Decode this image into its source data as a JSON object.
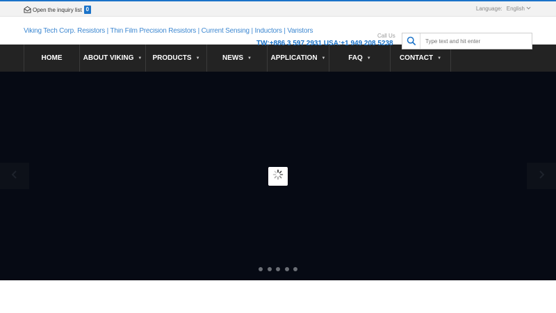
{
  "topbar": {
    "inquiry_label": "Open the inquiry list",
    "inquiry_count": "0",
    "language_label": "Language:",
    "language_value": "English"
  },
  "header": {
    "tagline": "Viking Tech Corp. Resistors | Thin Film Precision Resistors | Current Sensing | Inductors | Varistors",
    "call_us": "Call Us",
    "phone": "TW:+886 3 597 2931 USA:+1 949 208 5238"
  },
  "search": {
    "placeholder": "Type text and hit enter"
  },
  "nav": {
    "items": [
      {
        "label": "HOME",
        "has_dropdown": false
      },
      {
        "label": "ABOUT VIKING",
        "has_dropdown": true
      },
      {
        "label": "PRODUCTS",
        "has_dropdown": true
      },
      {
        "label": "NEWS",
        "has_dropdown": true
      },
      {
        "label": "APPLICATION",
        "has_dropdown": true
      },
      {
        "label": "FAQ",
        "has_dropdown": true
      },
      {
        "label": "CONTACT",
        "has_dropdown": true
      }
    ]
  },
  "slider": {
    "dot_count": 5
  },
  "colors": {
    "accent": "#1b73c9",
    "nav_bg": "#232323",
    "hero_bg": "#060a14"
  }
}
